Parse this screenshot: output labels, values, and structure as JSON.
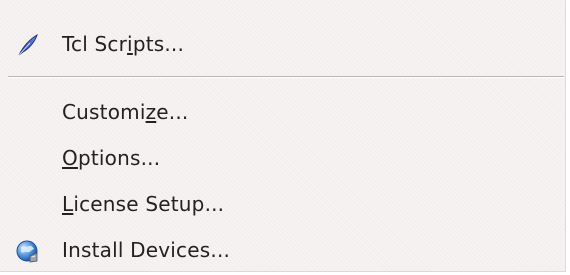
{
  "menu": {
    "items": [
      {
        "label": "Tcl Scripts...",
        "mnemonic": "i",
        "icon": "feather-pen-icon"
      },
      {
        "label": "Customize...",
        "mnemonic": "z",
        "icon": null
      },
      {
        "label": "Options...",
        "mnemonic": "O",
        "icon": null
      },
      {
        "label": "License Setup...",
        "mnemonic": "L",
        "icon": null
      },
      {
        "label": "Install Devices...",
        "mnemonic": null,
        "icon": "globe-install-icon"
      }
    ]
  },
  "colors": {
    "menu_background": "#f4efef",
    "text": "#222222",
    "separator": "#b9b3b3",
    "feather_icon": "#3a5fcd",
    "globe_icon": "#4a8fd8"
  }
}
